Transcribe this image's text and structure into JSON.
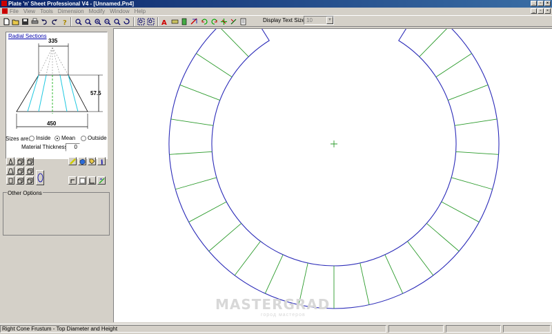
{
  "window": {
    "title": "Plate 'n' Sheet Professional V4 - [Unnamed.Pn4]"
  },
  "menu": {
    "items": [
      "File",
      "View",
      "Tools",
      "Dimension",
      "Modify",
      "Window",
      "Help"
    ]
  },
  "toolbar": {
    "icons": [
      "new-file-icon",
      "open-folder-icon",
      "save-icon",
      "print-icon",
      "undo-icon",
      "redo-icon",
      "help-icon",
      "zoom-extents-icon",
      "zoom-window-icon",
      "zoom-in-icon",
      "zoom-out-icon",
      "zoom-previous-icon",
      "pan-icon",
      "zoom-all-icon",
      "redraw-icon",
      "text-icon",
      "dimension-icon",
      "layer-icon",
      "rotate-icon",
      "rotate-cw-icon",
      "rotate-ccw-icon",
      "flip-icon",
      "mirror-icon",
      "grid-icon",
      "properties-icon"
    ],
    "display_text_size_label": "Display Text Size:",
    "display_text_size_value": "10"
  },
  "panel": {
    "preview_title": "Radial Sections",
    "dim_top": "335",
    "dim_bottom": "450",
    "dim_height": "57.5",
    "sizes_label": "Sizes are:",
    "size_options": [
      "Inside",
      "Mean",
      "Outside"
    ],
    "selected_size": "Mean",
    "material_thickness_label": "Material Thickness",
    "material_thickness_value": "0",
    "other_options_label": "Other Options"
  },
  "status": {
    "text": "Right Cone Frustum - Top Diameter and Height"
  },
  "watermark": {
    "main": "MASTERGRAD",
    "sub": "город мастеров"
  },
  "colors": {
    "title_start": "#0a246a",
    "title_end": "#3a6ea5",
    "outline": "#2a2ab8",
    "radial": "#2a9a2a",
    "cone_fill": "#1ec8e0"
  }
}
